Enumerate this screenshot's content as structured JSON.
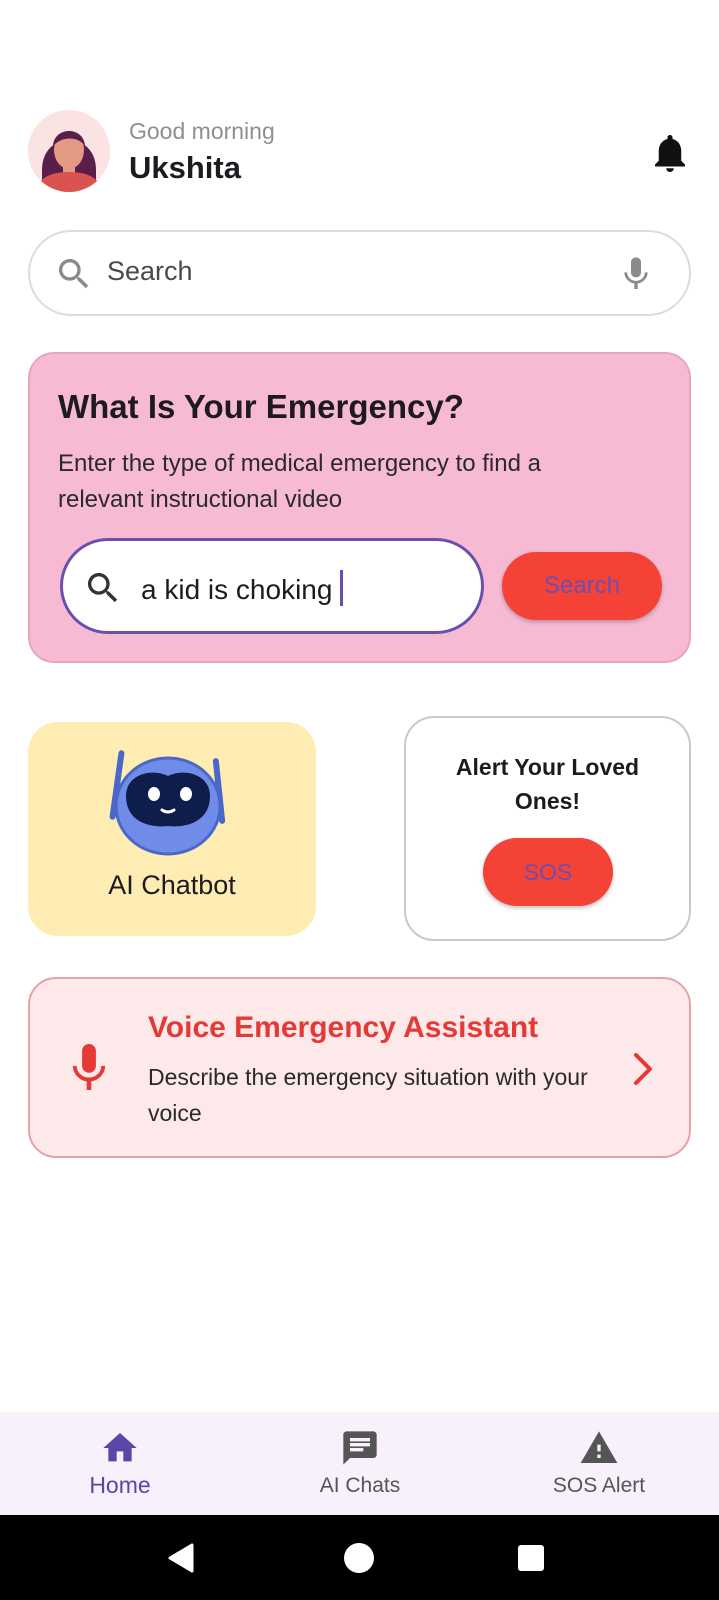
{
  "header": {
    "greeting": "Good morning",
    "username": "Ukshita",
    "notification_icon": "bell-icon"
  },
  "search": {
    "placeholder": "Search",
    "icon": "search-icon",
    "mic_icon": "mic-icon"
  },
  "emergency": {
    "title": "What Is Your Emergency?",
    "description": "Enter the type of medical emergency to find a relevant instructional video",
    "input_value": "a kid is choking",
    "button_label": "Search"
  },
  "chatbot": {
    "label": "AI Chatbot",
    "icon": "robot-icon"
  },
  "sos": {
    "title": "Alert Your Loved Ones!",
    "button_label": "SOS"
  },
  "voice": {
    "title": "Voice Emergency Assistant",
    "description": "Describe the emergency situation with your voice",
    "icon": "mic-icon"
  },
  "nav": {
    "items": [
      {
        "label": "Home",
        "icon": "home-icon",
        "active": true
      },
      {
        "label": "AI Chats",
        "icon": "chat-icon",
        "active": false
      },
      {
        "label": "SOS Alert",
        "icon": "warning-icon",
        "active": false
      }
    ]
  },
  "colors": {
    "accent": "#6a4fb0",
    "danger": "#f44336",
    "emergency_card": "#f7bad3",
    "chatbot_card": "#ffecb3",
    "voice_card": "#fde8ea"
  }
}
